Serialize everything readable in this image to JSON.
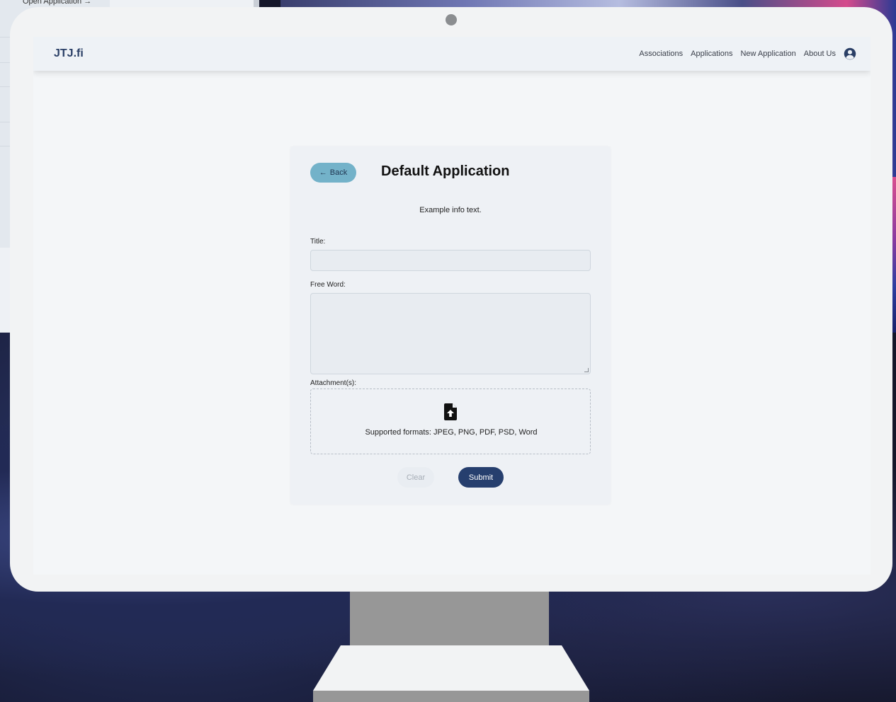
{
  "background": {
    "open_application_link": "Open Application →"
  },
  "navbar": {
    "brand": "JTJ.fi",
    "links": [
      {
        "label": "Associations"
      },
      {
        "label": "Applications"
      },
      {
        "label": "New Application"
      },
      {
        "label": "About Us"
      }
    ],
    "account_icon": "account-circle-icon"
  },
  "form": {
    "back_label": "Back",
    "title": "Default Application",
    "info_text": "Example info text.",
    "title_label": "Title:",
    "title_value": "",
    "free_word_label": "Free Word:",
    "free_word_value": "",
    "attachments_label": "Attachment(s):",
    "attachment_icon": "file-upload-icon",
    "supported_formats": "Supported formats: JPEG, PNG, PDF, PSD, Word",
    "clear_label": "Clear",
    "submit_label": "Submit"
  },
  "colors": {
    "brand": "#2a3f66",
    "back_button": "#73b2c9",
    "submit_button": "#263f6e",
    "clear_button": "#e9edf2"
  }
}
